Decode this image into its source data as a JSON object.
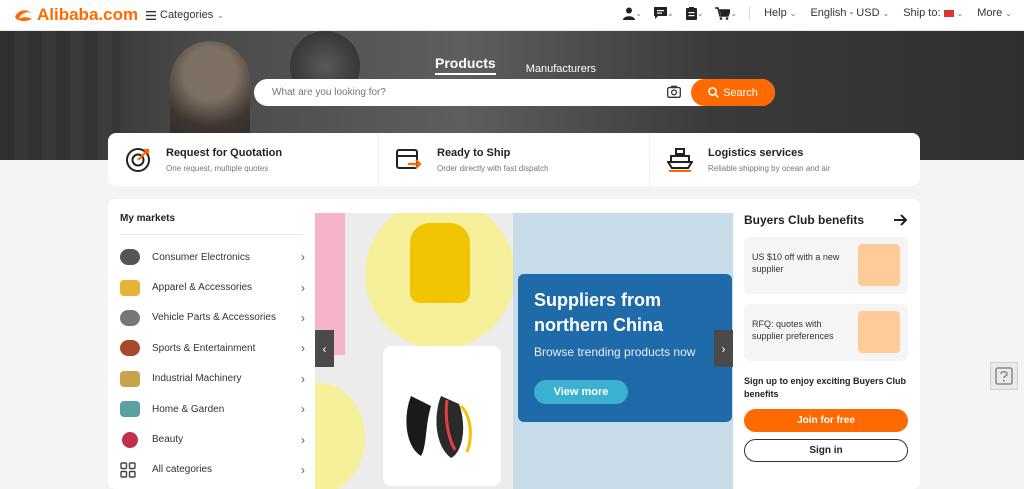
{
  "header": {
    "logo_text": "Alibaba.com",
    "categories_label": "Categories",
    "help_label": "Help",
    "language_label": "English - USD",
    "ship_to_label": "Ship to:",
    "more_label": "More",
    "icons": [
      "user-icon",
      "messages-icon",
      "orders-icon",
      "cart-icon"
    ]
  },
  "hero": {
    "tabs": [
      "Products",
      "Manufacturers"
    ],
    "active_tab": "Products",
    "search_placeholder": "What are you looking for?",
    "search_button": "Search"
  },
  "services": [
    {
      "title": "Request for Quotation",
      "subtitle": "One request, multiple quotes",
      "icon": "target-icon"
    },
    {
      "title": "Ready to Ship",
      "subtitle": "Order directly with fast dispatch",
      "icon": "box-arrow-icon"
    },
    {
      "title": "Logistics services",
      "subtitle": "Reliable shipping by ocean and air",
      "icon": "ship-icon"
    }
  ],
  "markets": {
    "title": "My markets",
    "items": [
      {
        "label": "Consumer Electronics",
        "color": "#555555"
      },
      {
        "label": "Apparel & Accessories",
        "color": "#e8b23a"
      },
      {
        "label": "Vehicle Parts & Accessories",
        "color": "#777777"
      },
      {
        "label": "Sports & Entertainment",
        "color": "#a84a2a"
      },
      {
        "label": "Industrial Machinery",
        "color": "#c9a24a"
      },
      {
        "label": "Home & Garden",
        "color": "#5aa0a0"
      },
      {
        "label": "Beauty",
        "color": "#c0304a"
      },
      {
        "label": "All categories",
        "color": "#444444"
      }
    ]
  },
  "banner": {
    "headline_line1": "Suppliers from",
    "headline_line2": "northern China",
    "subtitle": "Browse trending products now",
    "cta": "View more"
  },
  "buyers_club": {
    "title": "Buyers Club benefits",
    "cards": [
      {
        "text": "US $10 off with a new supplier"
      },
      {
        "text": "RFQ: quotes with supplier preferences"
      }
    ],
    "signup_text": "Sign up to enjoy exciting Buyers Club benefits",
    "join_button": "Join for free",
    "signin_button": "Sign in"
  },
  "colors": {
    "brand": "#ff6a00",
    "promo": "#1f6aa8",
    "promo_button": "#3ab2cf"
  }
}
